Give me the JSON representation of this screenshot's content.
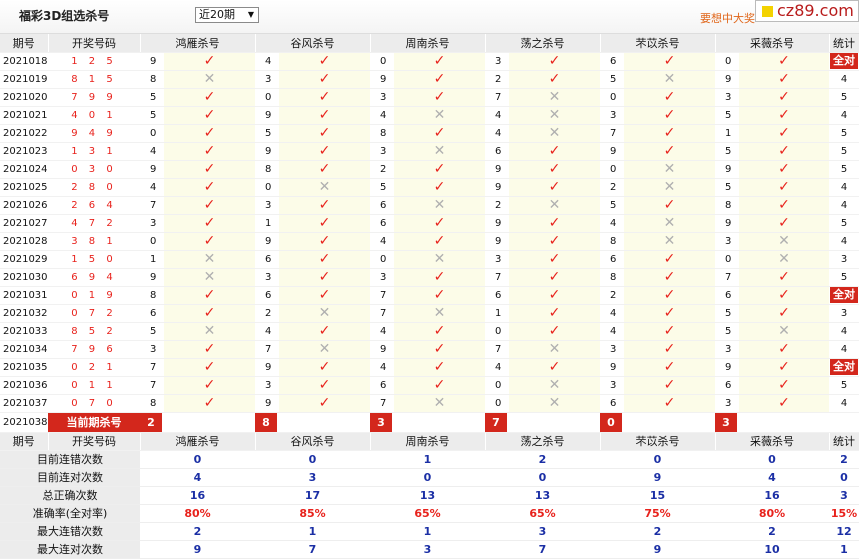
{
  "header": {
    "title": "福彩3D组选杀号",
    "period_select": "近20期",
    "promo": "要想中大奖",
    "watermark": "cz89.com"
  },
  "columns": {
    "period": "期号",
    "draw": "开奖号码",
    "experts": [
      "鸿雁杀号",
      "谷风杀号",
      "周南杀号",
      "荡之杀号",
      "芣苡杀号",
      "采薇杀号"
    ],
    "stat": "统计"
  },
  "rows": [
    {
      "period": "2021018",
      "draw": "1 2 5",
      "kills": [
        9,
        4,
        0,
        3,
        6,
        0
      ],
      "ok": [
        1,
        1,
        1,
        1,
        1,
        1
      ],
      "count": "全对"
    },
    {
      "period": "2021019",
      "draw": "8 1 5",
      "kills": [
        8,
        3,
        9,
        2,
        5,
        9
      ],
      "ok": [
        0,
        1,
        1,
        1,
        0,
        1
      ],
      "count": "4"
    },
    {
      "period": "2021020",
      "draw": "7 9 9",
      "kills": [
        5,
        0,
        3,
        7,
        0,
        3
      ],
      "ok": [
        1,
        1,
        1,
        0,
        1,
        1
      ],
      "count": "5"
    },
    {
      "period": "2021021",
      "draw": "4 0 1",
      "kills": [
        5,
        9,
        4,
        4,
        3,
        5
      ],
      "ok": [
        1,
        1,
        0,
        0,
        1,
        1
      ],
      "count": "4"
    },
    {
      "period": "2021022",
      "draw": "9 4 9",
      "kills": [
        0,
        5,
        8,
        4,
        7,
        1
      ],
      "ok": [
        1,
        1,
        1,
        0,
        1,
        1
      ],
      "count": "5"
    },
    {
      "period": "2021023",
      "draw": "1 3 1",
      "kills": [
        4,
        9,
        3,
        6,
        9,
        5
      ],
      "ok": [
        1,
        1,
        0,
        1,
        1,
        1
      ],
      "count": "5"
    },
    {
      "period": "2021024",
      "draw": "0 3 0",
      "kills": [
        9,
        8,
        2,
        9,
        0,
        9
      ],
      "ok": [
        1,
        1,
        1,
        1,
        0,
        1
      ],
      "count": "5"
    },
    {
      "period": "2021025",
      "draw": "2 8 0",
      "kills": [
        4,
        0,
        5,
        9,
        2,
        5
      ],
      "ok": [
        1,
        0,
        1,
        1,
        0,
        1
      ],
      "count": "4"
    },
    {
      "period": "2021026",
      "draw": "2 6 4",
      "kills": [
        7,
        3,
        6,
        2,
        5,
        8
      ],
      "ok": [
        1,
        1,
        0,
        0,
        1,
        1
      ],
      "count": "4"
    },
    {
      "period": "2021027",
      "draw": "4 7 2",
      "kills": [
        3,
        1,
        6,
        9,
        4,
        9
      ],
      "ok": [
        1,
        1,
        1,
        1,
        0,
        1
      ],
      "count": "5"
    },
    {
      "period": "2021028",
      "draw": "3 8 1",
      "kills": [
        0,
        9,
        4,
        9,
        8,
        3
      ],
      "ok": [
        1,
        1,
        1,
        1,
        0,
        0
      ],
      "count": "4"
    },
    {
      "period": "2021029",
      "draw": "1 5 0",
      "kills": [
        1,
        6,
        0,
        3,
        6,
        0
      ],
      "ok": [
        0,
        1,
        0,
        1,
        1,
        0
      ],
      "count": "3"
    },
    {
      "period": "2021030",
      "draw": "6 9 4",
      "kills": [
        9,
        3,
        3,
        7,
        8,
        7
      ],
      "ok": [
        0,
        1,
        1,
        1,
        1,
        1
      ],
      "count": "5"
    },
    {
      "period": "2021031",
      "draw": "0 1 9",
      "kills": [
        8,
        6,
        7,
        6,
        2,
        6
      ],
      "ok": [
        1,
        1,
        1,
        1,
        1,
        1
      ],
      "count": "全对"
    },
    {
      "period": "2021032",
      "draw": "0 7 2",
      "kills": [
        6,
        2,
        7,
        1,
        4,
        5
      ],
      "ok": [
        1,
        0,
        0,
        1,
        1,
        1
      ],
      "count": "3"
    },
    {
      "period": "2021033",
      "draw": "8 5 2",
      "kills": [
        5,
        4,
        4,
        0,
        4,
        5
      ],
      "ok": [
        0,
        1,
        1,
        1,
        1,
        0
      ],
      "count": "4"
    },
    {
      "period": "2021034",
      "draw": "7 9 6",
      "kills": [
        3,
        7,
        9,
        7,
        3,
        3
      ],
      "ok": [
        1,
        0,
        1,
        0,
        1,
        1
      ],
      "count": "4"
    },
    {
      "period": "2021035",
      "draw": "0 2 1",
      "kills": [
        7,
        9,
        4,
        4,
        9,
        9
      ],
      "ok": [
        1,
        1,
        1,
        1,
        1,
        1
      ],
      "count": "全对"
    },
    {
      "period": "2021036",
      "draw": "0 1 1",
      "kills": [
        7,
        3,
        6,
        0,
        3,
        6
      ],
      "ok": [
        1,
        1,
        1,
        0,
        1,
        1
      ],
      "count": "5"
    },
    {
      "period": "2021037",
      "draw": "0 7 0",
      "kills": [
        8,
        9,
        7,
        0,
        6,
        3
      ],
      "ok": [
        1,
        1,
        0,
        0,
        1,
        1
      ],
      "count": "4"
    }
  ],
  "current": {
    "period": "2021038",
    "label": "当前期杀号",
    "kills": [
      "2",
      "8",
      "3",
      "7",
      "0",
      "3"
    ]
  },
  "stats": [
    {
      "label": "目前连错次数",
      "values": [
        "0",
        "0",
        "1",
        "2",
        "0",
        "0"
      ],
      "total": "2"
    },
    {
      "label": "目前连对次数",
      "values": [
        "4",
        "3",
        "0",
        "0",
        "9",
        "4"
      ],
      "total": "0"
    },
    {
      "label": "总正确次数",
      "values": [
        "16",
        "17",
        "13",
        "13",
        "15",
        "16"
      ],
      "total": "3"
    },
    {
      "label": "准确率(全对率)",
      "values": [
        "80%",
        "85%",
        "65%",
        "65%",
        "75%",
        "80%"
      ],
      "total": "15%",
      "red": true
    },
    {
      "label": "最大连错次数",
      "values": [
        "2",
        "1",
        "1",
        "3",
        "2",
        "2"
      ],
      "total": "12"
    },
    {
      "label": "最大连对次数",
      "values": [
        "9",
        "7",
        "3",
        "7",
        "9",
        "10"
      ],
      "total": "1"
    }
  ],
  "colors": {
    "accent": "#d3271c",
    "ok": "#e8221c",
    "no": "#b0b0b0",
    "stat": "#1b2fa5"
  }
}
